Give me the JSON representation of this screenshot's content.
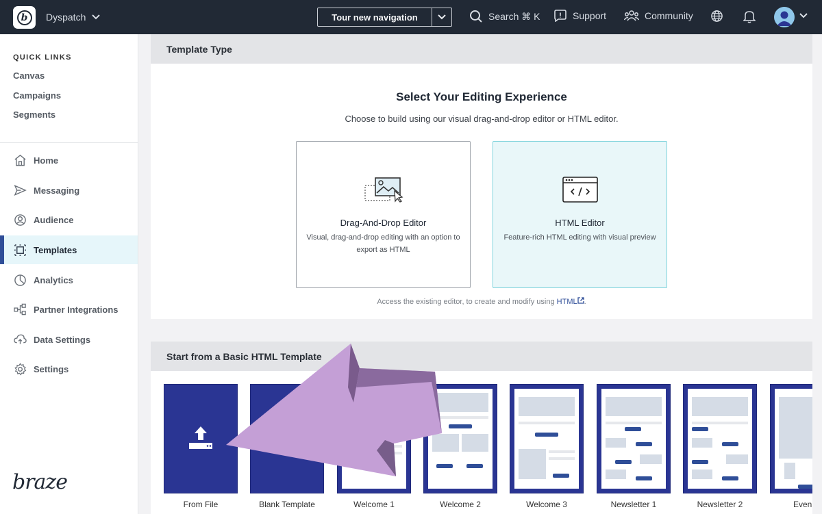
{
  "topbar": {
    "company": "Dyspatch",
    "tour_label": "Tour new navigation",
    "search_label": "Search ⌘ K",
    "support_label": "Support",
    "community_label": "Community"
  },
  "sidebar": {
    "quick_links_title": "QUICK LINKS",
    "quick_links": [
      "Canvas",
      "Campaigns",
      "Segments"
    ],
    "items": [
      {
        "label": "Home"
      },
      {
        "label": "Messaging"
      },
      {
        "label": "Audience"
      },
      {
        "label": "Templates"
      },
      {
        "label": "Analytics"
      },
      {
        "label": "Partner Integrations"
      },
      {
        "label": "Data Settings"
      },
      {
        "label": "Settings"
      }
    ],
    "brand": "braze"
  },
  "template_type": {
    "header": "Template Type",
    "title": "Select Your Editing Experience",
    "subtitle": "Choose to build using our visual drag-and-drop editor or HTML editor.",
    "cards": [
      {
        "title": "Drag-And-Drop Editor",
        "desc": "Visual, drag-and-drop editing with an option to export as HTML"
      },
      {
        "title": "HTML Editor",
        "desc": "Feature-rich HTML editing with visual preview"
      }
    ],
    "access_text": "Access the existing editor, to create and modify using",
    "access_link": "HTML",
    "access_end": "."
  },
  "basic_templates": {
    "header": "Start from a Basic HTML Template",
    "items": [
      "From File",
      "Blank Template",
      "Welcome 1",
      "Welcome 2",
      "Welcome 3",
      "Newsletter 1",
      "Newsletter 2",
      "Even"
    ]
  },
  "colors": {
    "topbar": "#212935",
    "accent": "#2f4e98",
    "template_tile": "#2a3593",
    "selected_card": "#e9f7f9",
    "arrow": "#c49fd6"
  }
}
